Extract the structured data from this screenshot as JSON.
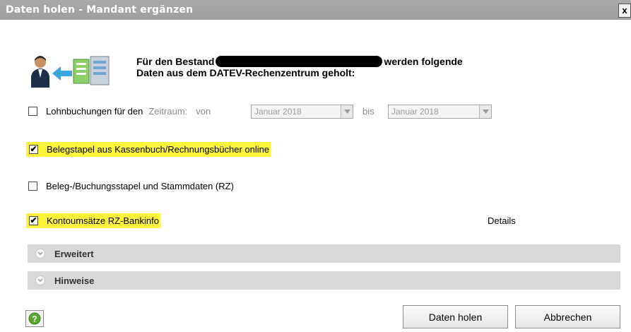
{
  "window": {
    "title": "Daten holen - Mandant ergänzen",
    "close_label": "x"
  },
  "header": {
    "line1_prefix": "Für den Bestand",
    "line1_suffix": "werden folgende",
    "line2": "Daten aus dem DATEV-Rechenzentrum geholt:"
  },
  "options": {
    "lohn": {
      "checked": false,
      "label": "Lohnbuchungen für den",
      "zeitraum_label": "Zeitraum:",
      "von_label": "von",
      "von_value": "Januar 2018",
      "bis_label": "bis",
      "bis_value": "Januar 2018"
    },
    "belegstapel": {
      "checked": true,
      "label": "Belegstapel aus Kassenbuch/Rechnungsbücher online"
    },
    "stammdaten": {
      "checked": false,
      "label": "Beleg-/Buchungsstapel und Stammdaten (RZ)"
    },
    "konto": {
      "checked": true,
      "label": "Kontoumsätze RZ-Bankinfo",
      "details_link": "Details"
    }
  },
  "sections": {
    "erweitert": "Erweitert",
    "hinweise": "Hinweise"
  },
  "buttons": {
    "ok": "Daten holen",
    "cancel": "Abbrechen"
  },
  "colors": {
    "highlight": "#fff43a",
    "titlebar": "#a3a3a3",
    "section_bg": "#d9d9d9",
    "help_icon": "#5aa832"
  },
  "checkmark": "✔"
}
